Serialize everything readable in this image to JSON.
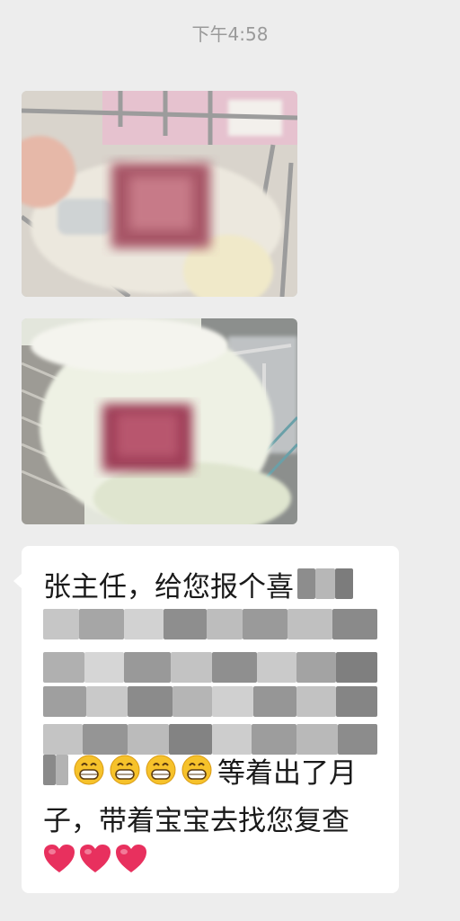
{
  "status": {
    "time": "下午4:58"
  },
  "photos": [
    {
      "name": "photo-1",
      "kind": "newborn-in-crib"
    },
    {
      "name": "photo-2",
      "kind": "newborn-wrapped-in-blanket"
    }
  ],
  "message": {
    "line1": "张主任，给您报个喜",
    "line6_text": "等着出了月",
    "line7": "子，带着宝宝去找您复查",
    "emoji": [
      "grin-icon",
      "grin-icon",
      "grin-icon",
      "grin-icon"
    ],
    "hearts": [
      "heart-icon",
      "heart-icon",
      "heart-icon"
    ]
  },
  "colors": {
    "background": "#ededed",
    "bubble": "#ffffff",
    "text": "#1a1a1a",
    "timestamp": "#9a9a9a",
    "heart": "#e8305e",
    "emoji": "#f6c22b"
  }
}
